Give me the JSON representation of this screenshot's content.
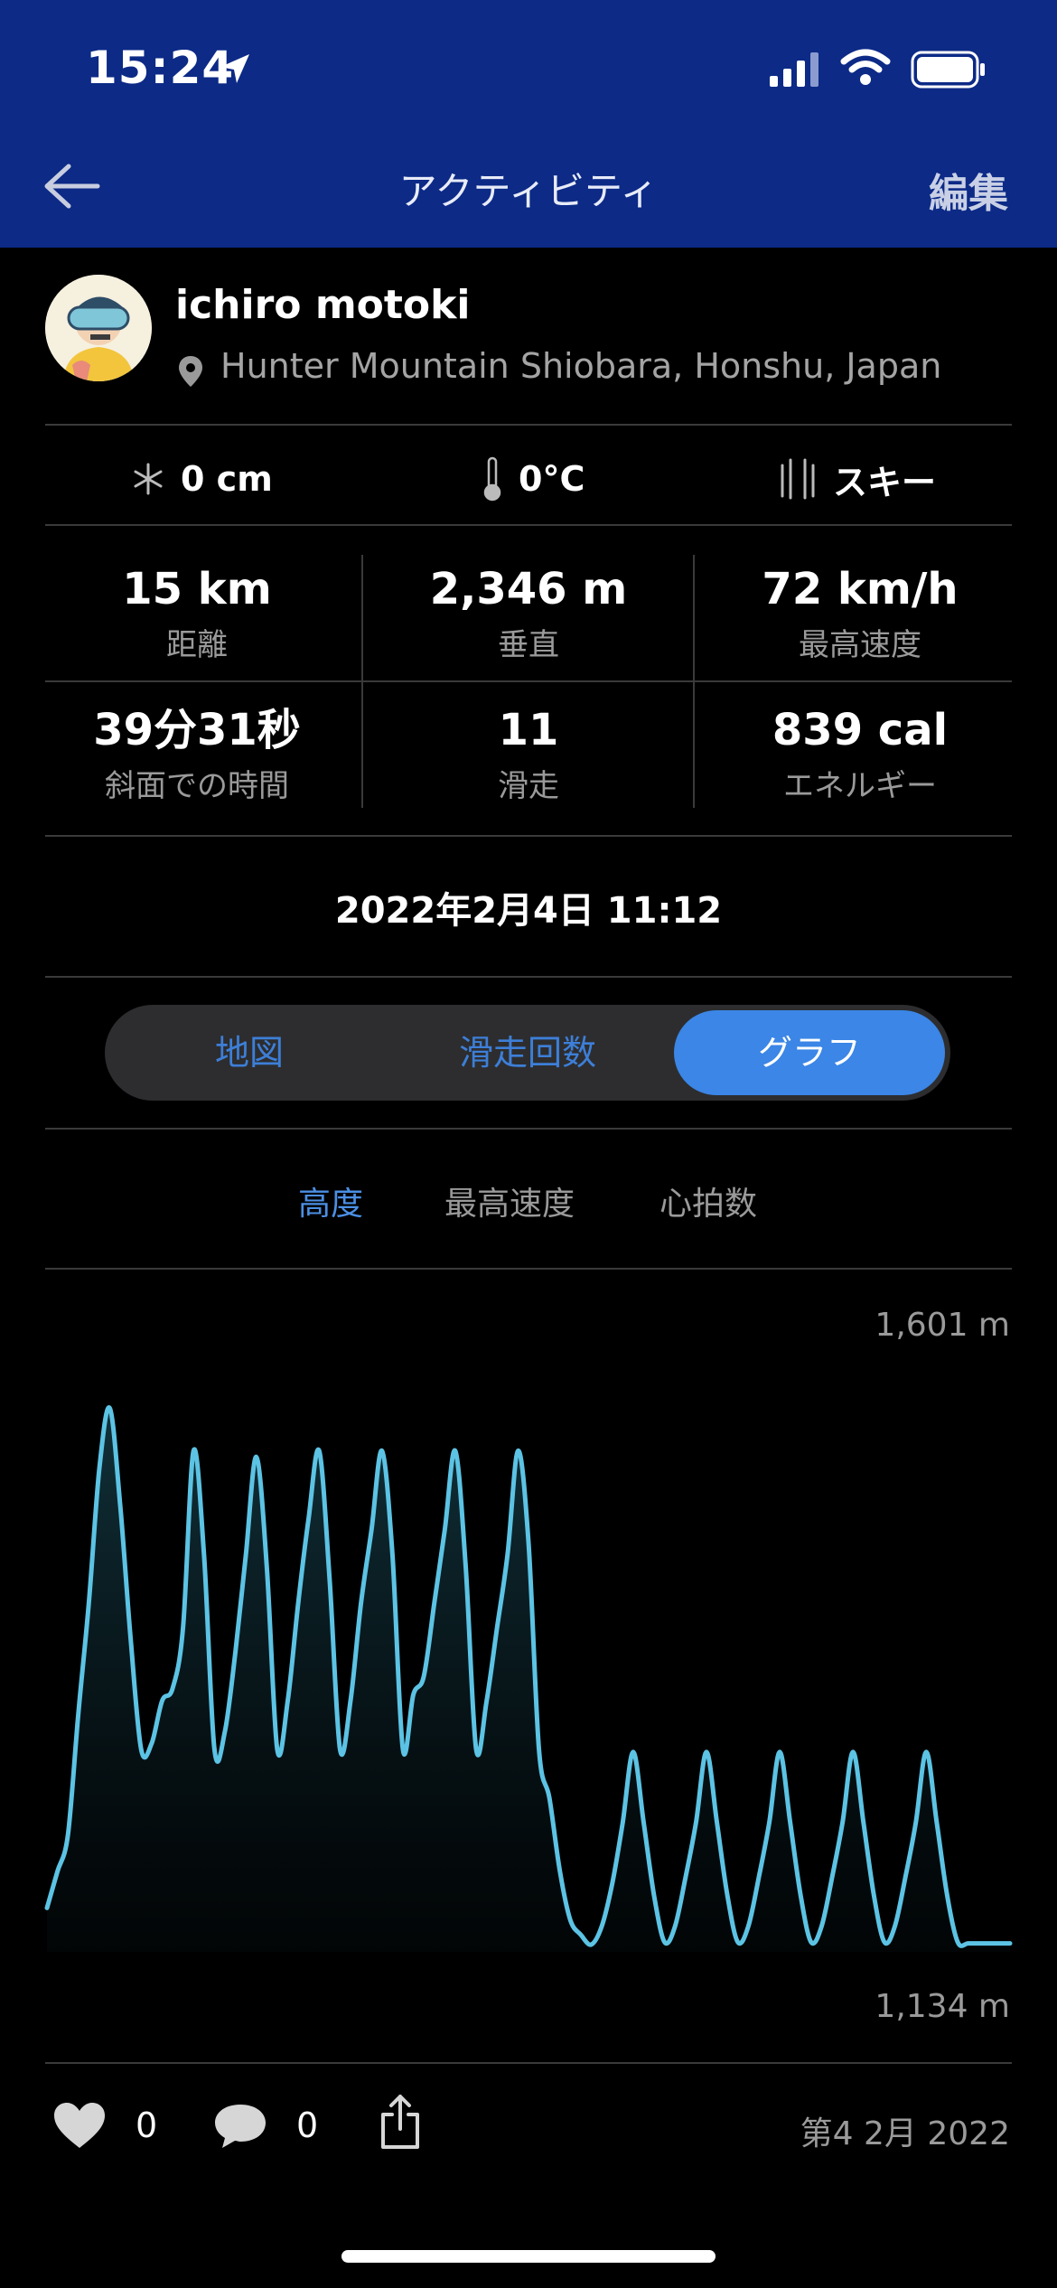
{
  "status_bar": {
    "time": "15:24"
  },
  "header": {
    "title": "アクティビティ",
    "edit_label": "編集"
  },
  "profile": {
    "name": "ichiro motoki",
    "location": "Hunter Mountain Shiobara, Honshu, Japan"
  },
  "conditions": [
    {
      "icon": "snowflake-icon",
      "value": "0 cm"
    },
    {
      "icon": "thermometer-icon",
      "value": "0°C"
    },
    {
      "icon": "ski-icon",
      "value": "スキー"
    }
  ],
  "stats": [
    {
      "value": "15 km",
      "label": "距離"
    },
    {
      "value": "2,346 m",
      "label": "垂直"
    },
    {
      "value": "72 km/h",
      "label": "最高速度"
    },
    {
      "value": "39分31秒",
      "label": "斜面での時間"
    },
    {
      "value": "11",
      "label": "滑走"
    },
    {
      "value": "839 cal",
      "label": "エネルギー"
    }
  ],
  "activity_datetime": "2022年2月4日 11:12",
  "segments": {
    "items": [
      "地図",
      "滑走回数",
      "グラフ"
    ],
    "selected": "グラフ"
  },
  "chart_tabs": {
    "items": [
      "高度",
      "最高速度",
      "心拍数"
    ],
    "selected": "高度"
  },
  "chart_data": {
    "type": "area",
    "ylim": [
      1134,
      1601
    ],
    "y_max_label": "1,601 m",
    "y_min_label": "1,134 m",
    "x": [
      0,
      1,
      2,
      3,
      4,
      5,
      6,
      7,
      8,
      9,
      10,
      11,
      12,
      13,
      14,
      15,
      16,
      17,
      18,
      19,
      20,
      21,
      22,
      23,
      24,
      25,
      26,
      27,
      28,
      29,
      30,
      31,
      32,
      33,
      34,
      35,
      36,
      37,
      38,
      39,
      40,
      41,
      42,
      43,
      44,
      45,
      46,
      47,
      48,
      49,
      50,
      51,
      52,
      53,
      54,
      55,
      56,
      57,
      58,
      59,
      60,
      61,
      62,
      63,
      64,
      65,
      66,
      67,
      68,
      69,
      70,
      71,
      72,
      73,
      74,
      75,
      76,
      77,
      78,
      79,
      80,
      81,
      82,
      83,
      84,
      85,
      86,
      87,
      88,
      89,
      90,
      91,
      92
    ],
    "values": [
      1170,
      1200,
      1230,
      1330,
      1420,
      1530,
      1580,
      1500,
      1390,
      1300,
      1305,
      1340,
      1350,
      1400,
      1545,
      1460,
      1300,
      1315,
      1380,
      1460,
      1540,
      1450,
      1300,
      1340,
      1420,
      1490,
      1545,
      1440,
      1300,
      1340,
      1420,
      1480,
      1545,
      1460,
      1300,
      1345,
      1360,
      1420,
      1480,
      1545,
      1450,
      1300,
      1340,
      1400,
      1460,
      1545,
      1470,
      1300,
      1260,
      1200,
      1160,
      1148,
      1140,
      1155,
      1190,
      1240,
      1298,
      1240,
      1180,
      1142,
      1155,
      1195,
      1240,
      1298,
      1240,
      1180,
      1142,
      1155,
      1195,
      1240,
      1298,
      1240,
      1180,
      1142,
      1155,
      1195,
      1240,
      1298,
      1240,
      1180,
      1142,
      1155,
      1195,
      1240,
      1298,
      1240,
      1180,
      1142,
      1141,
      1141,
      1141,
      1141,
      1141
    ],
    "line_color": "#5cc3e4"
  },
  "footer": {
    "likes": "0",
    "comments": "0",
    "date": "第4 2月 2022"
  }
}
